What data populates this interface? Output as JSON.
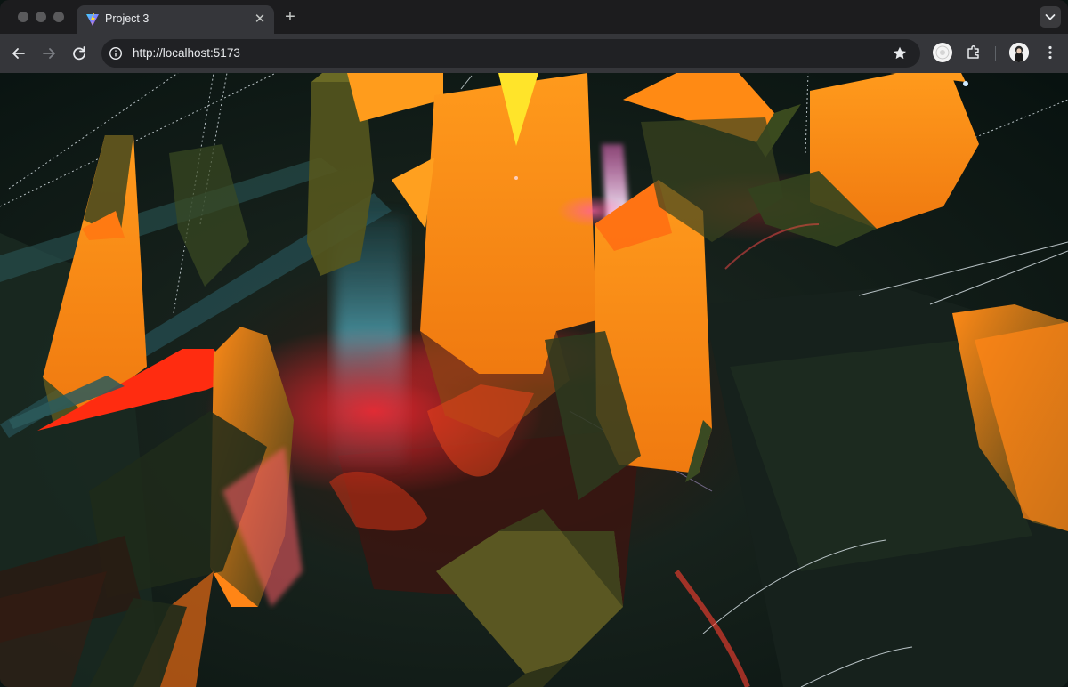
{
  "window": {
    "tab": {
      "title": "Project 3",
      "favicon": "vite-logo-icon",
      "close_icon": "close-icon"
    },
    "new_tab_icon": "plus-icon",
    "tab_menu_icon": "chevron-down-icon"
  },
  "toolbar": {
    "back_icon": "arrow-left-icon",
    "forward_icon": "arrow-right-icon",
    "reload_icon": "reload-icon",
    "site_info_icon": "info-icon",
    "url": "http://localhost:5173",
    "bookmark_icon": "star-icon",
    "extensions_icon": "puzzle-icon",
    "profile_icon": "avatar",
    "menu_icon": "kebab-menu-icon"
  },
  "colors": {
    "accent_orange": "#ff8a17",
    "accent_red": "#ff2a12",
    "dark_green": "#2f3b1c",
    "teal": "#3c8c9a"
  }
}
